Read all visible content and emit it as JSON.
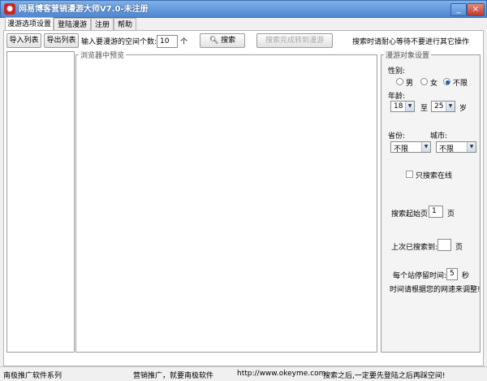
{
  "window": {
    "title": "网易博客营销漫游大师V7.0-未注册",
    "app_icon": "app-logo-icon",
    "minimize_label": "_",
    "close_label": "×"
  },
  "tabs": [
    "漫游选项设置",
    "登陆漫游",
    "注册",
    "帮助"
  ],
  "toolbar": {
    "import_label": "导入列表",
    "export_label": "导出列表",
    "count_label": "输入要漫游的空间个数:",
    "count_value": "10",
    "count_unit": "个",
    "search_label": "搜索",
    "search_icon": "magnifier-icon",
    "transfer_label": "搜索完成转到漫游",
    "hint": "搜索时请耐心等待不要进行其它操作"
  },
  "browser": {
    "legend": "浏览器中预览"
  },
  "settings": {
    "legend": "漫游对象设置",
    "gender_label": "性别:",
    "gender_options": [
      "男",
      "女",
      "不限"
    ],
    "gender_selected": "不限",
    "age_label": "年龄:",
    "age_from": "18",
    "age_to_label": "至",
    "age_to": "25",
    "age_unit": "岁",
    "province_label": "省份:",
    "city_label": "城市:",
    "province_value": "不限",
    "city_value": "不限",
    "online_only_label": "只搜索在线",
    "online_only_checked": false,
    "start_page_label": "搜索起始页:",
    "start_page_value": "1",
    "start_page_unit": "页",
    "last_page_label": "上次已搜索到:",
    "last_page_value": "",
    "last_page_unit": "页",
    "stay_label": "每个站停留时间:",
    "stay_value": "5",
    "stay_unit": "秒",
    "speed_hint": "时间请根据您的网速来调整!"
  },
  "status": {
    "series": "南极推广软件系列",
    "slogan": "营销推广，就要南极软件",
    "url": "http://www.okeyme.com",
    "notice": "搜索之后,一定要先登陆之后再踩空间!"
  },
  "colors": {
    "title_gradient_top": "#7fb0e8",
    "title_gradient_bottom": "#4f86cf",
    "radio_selected": "#1e5aa8",
    "close_button": "#c0392b"
  }
}
